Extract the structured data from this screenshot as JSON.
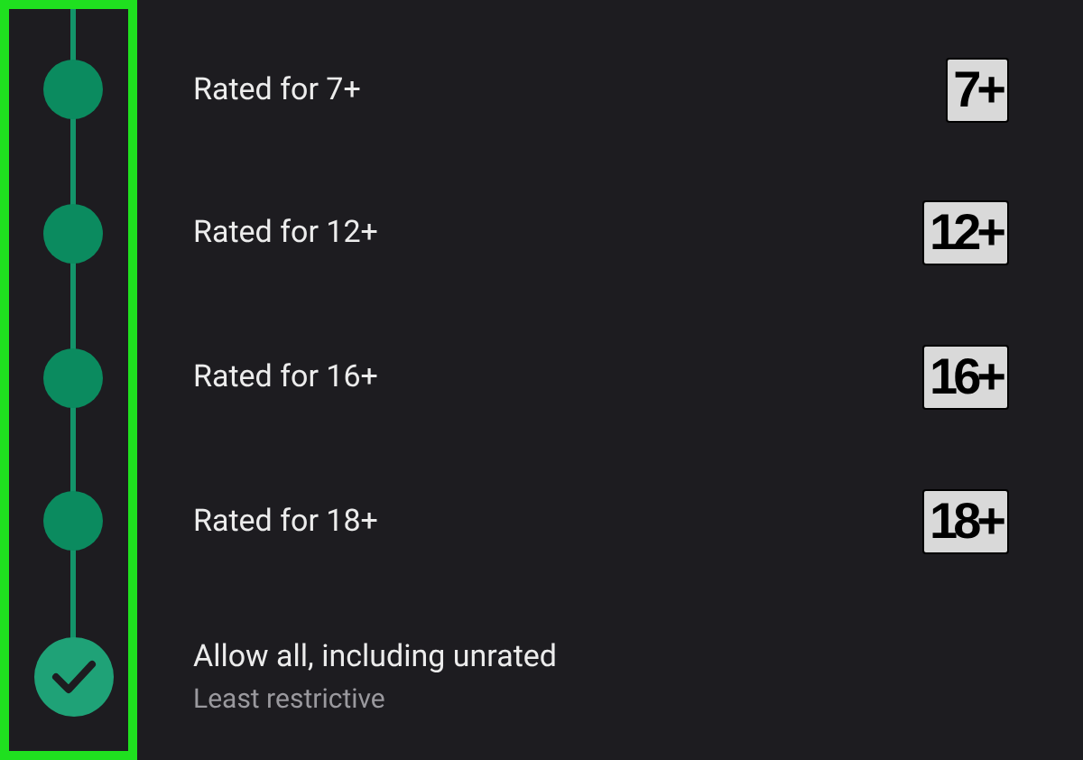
{
  "options": [
    {
      "label": "Rated for 7+",
      "badge": "7+",
      "selected": false
    },
    {
      "label": "Rated for 12+",
      "badge": "12+",
      "selected": false
    },
    {
      "label": "Rated for 16+",
      "badge": "16+",
      "selected": false
    },
    {
      "label": "Rated for 18+",
      "badge": "18+",
      "selected": false
    },
    {
      "label": "Allow all, including unrated",
      "sublabel": "Least restrictive",
      "selected": true
    }
  ]
}
